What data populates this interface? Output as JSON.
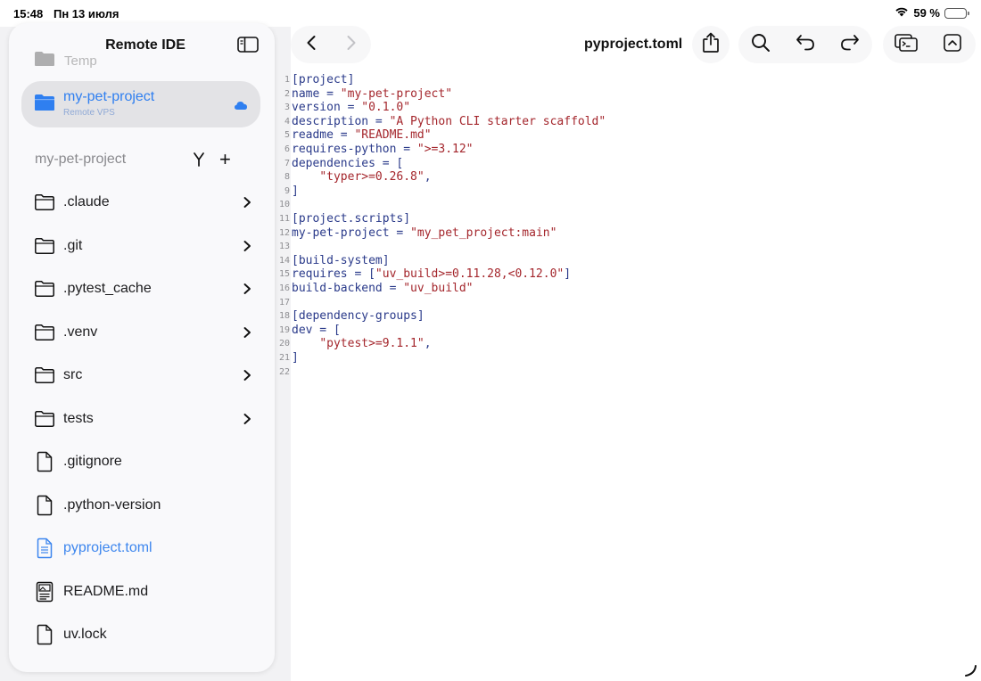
{
  "status": {
    "time": "15:48",
    "date": "Пн 13 июля",
    "battery_text": "59 %",
    "battery_level": 0.59
  },
  "sidebar": {
    "title": "Remote IDE",
    "temp_label": "Temp",
    "project": {
      "name": "my-pet-project",
      "subtitle": "Remote VPS"
    },
    "section_title": "my-pet-project",
    "items": [
      {
        "label": ".claude",
        "type": "folder"
      },
      {
        "label": ".git",
        "type": "folder"
      },
      {
        "label": ".pytest_cache",
        "type": "folder"
      },
      {
        "label": ".venv",
        "type": "folder"
      },
      {
        "label": "src",
        "type": "folder"
      },
      {
        "label": "tests",
        "type": "folder"
      },
      {
        "label": ".gitignore",
        "type": "file"
      },
      {
        "label": ".python-version",
        "type": "file"
      },
      {
        "label": "pyproject.toml",
        "type": "file-text",
        "active": true
      },
      {
        "label": "README.md",
        "type": "file-image"
      },
      {
        "label": "uv.lock",
        "type": "file"
      }
    ]
  },
  "editor": {
    "file_name": "pyproject.toml",
    "lines": [
      [
        {
          "t": "[project]"
        }
      ],
      [
        {
          "t": "name = "
        },
        {
          "t": "\"my-pet-project\"",
          "s": 1
        }
      ],
      [
        {
          "t": "version = "
        },
        {
          "t": "\"0.1.0\"",
          "s": 1
        }
      ],
      [
        {
          "t": "description = "
        },
        {
          "t": "\"A Python CLI starter scaffold\"",
          "s": 1
        }
      ],
      [
        {
          "t": "readme = "
        },
        {
          "t": "\"README.md\"",
          "s": 1
        }
      ],
      [
        {
          "t": "requires-python = "
        },
        {
          "t": "\">=3.12\"",
          "s": 1
        }
      ],
      [
        {
          "t": "dependencies = ["
        }
      ],
      [
        {
          "t": "    "
        },
        {
          "t": "\"typer>=0.26.8\"",
          "s": 1
        },
        {
          "t": ","
        }
      ],
      [
        {
          "t": "]"
        }
      ],
      [],
      [
        {
          "t": "[project.scripts]"
        }
      ],
      [
        {
          "t": "my-pet-project = "
        },
        {
          "t": "\"my_pet_project:main\"",
          "s": 1
        }
      ],
      [],
      [
        {
          "t": "[build-system]"
        }
      ],
      [
        {
          "t": "requires = ["
        },
        {
          "t": "\"uv_build>=0.11.28,<0.12.0\"",
          "s": 1
        },
        {
          "t": "]"
        }
      ],
      [
        {
          "t": "build-backend = "
        },
        {
          "t": "\"uv_build\"",
          "s": 1
        }
      ],
      [],
      [
        {
          "t": "[dependency-groups]"
        }
      ],
      [
        {
          "t": "dev = ["
        }
      ],
      [
        {
          "t": "    "
        },
        {
          "t": "\"pytest>=9.1.1\"",
          "s": 1
        },
        {
          "t": ","
        }
      ],
      [
        {
          "t": "]"
        }
      ],
      []
    ]
  },
  "icons": {
    "nav": [
      "back-icon",
      "forward-icon"
    ],
    "tools_group1": [
      "share-icon"
    ],
    "tools_group2": [
      "search-icon",
      "undo-icon",
      "redo-icon"
    ],
    "tools_group3": [
      "terminal-icon",
      "collapse-icon"
    ]
  },
  "colors": {
    "accent": "#2f7ff0",
    "code_text": "#2a3a8a",
    "code_string": "#a4262c"
  }
}
